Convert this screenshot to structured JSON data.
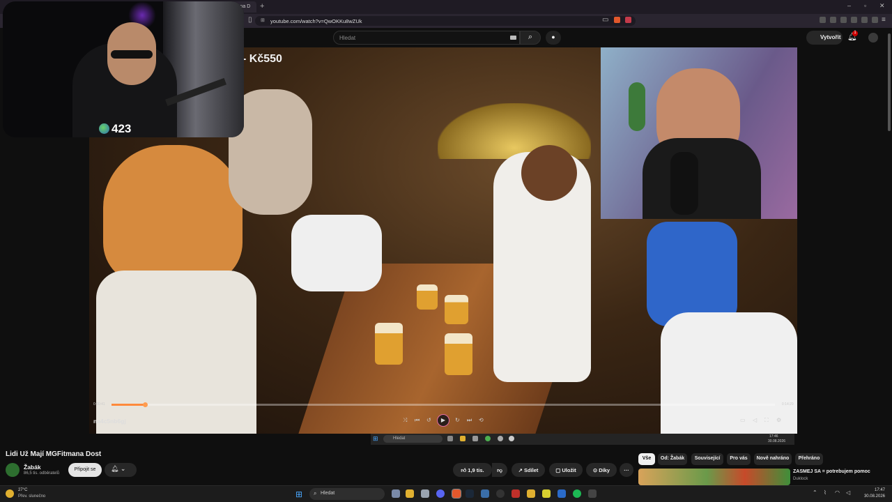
{
  "browser": {
    "tab_title": "na MGFitmana D",
    "url": "youtube.com/watch?v=QwOKKu8wZUk"
  },
  "youtube": {
    "search_placeholder": "Hledat",
    "create_label": "Vytvořit",
    "notification_count": "1"
  },
  "player": {
    "overlay_title": "- Kč550",
    "time_current": "0:00:41",
    "time_total": "0:14:29",
    "progress": 0.05,
    "channel_tag": "na4c5nb6gj",
    "inner_taskbar_search": "Hledat",
    "inner_clock_time": "17:46",
    "inner_clock_date": "30.08.2026"
  },
  "streamer_cam": {
    "viewer_count": "423"
  },
  "video": {
    "title": "Lidi Už Mají MGFitmana Dost",
    "channel_name": "Žabák",
    "subscribers": "86,5 tis. odběratelů",
    "subscribe_label": "Připojit se",
    "likes": "1,9 tis.",
    "share_label": "Sdílet",
    "save_label": "Uložit",
    "thanks_label": "Díky",
    "more_label": "···"
  },
  "chips": [
    "Vše",
    "Od: Žabák",
    "Související",
    "Pro vás",
    "Nově nahráno",
    "Přehráno"
  ],
  "recommendation": {
    "title": "ZASMEJ SA = potrebujem pomoc",
    "channel": "Duklock"
  },
  "taskbar": {
    "weather_temp": "27°C",
    "weather_desc": "Přev. slunečno",
    "search_placeholder": "Hledat",
    "time": "17:47",
    "date": "30.08.2026"
  },
  "colors": {
    "accent": "#ff8a3c",
    "background": "#0f0f0f",
    "chip_active": "#f1f1f1"
  }
}
